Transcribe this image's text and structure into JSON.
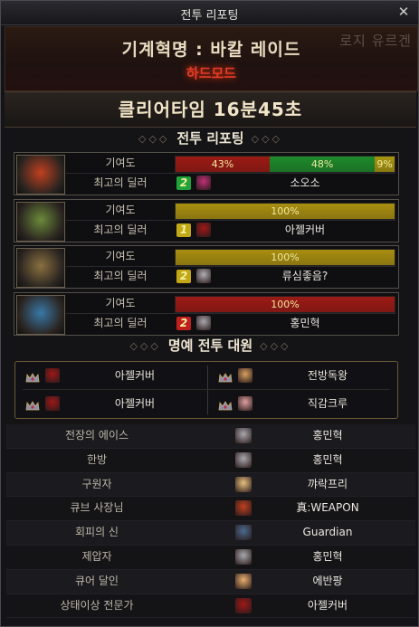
{
  "window": {
    "title": "전투 리포팅",
    "close_label": "✕"
  },
  "header": {
    "raid_name": "기계혁명 : 바칼 레이드",
    "mode": "하드모드",
    "ghost_text": "로지 유르겐"
  },
  "clear_time": "클리어타임 16분45초",
  "sections": {
    "report_title": "전투 리포팅",
    "honor_title": "명예 전투 대원",
    "ornament": "◇◇◇"
  },
  "labels": {
    "contribution": "기여도",
    "best_dealer": "최고의 딜러"
  },
  "parties": [
    {
      "portrait_color": "#c04020",
      "contribution": [
        {
          "pct": 43,
          "label": "43%",
          "color": "#9c1a14"
        },
        {
          "pct": 48,
          "label": "48%",
          "color": "#1e8a2a"
        },
        {
          "pct": 9,
          "label": "9%",
          "color": "#a89510"
        }
      ],
      "dealer_rank": "2",
      "rank_color": "#1fa33a",
      "dealer_face": "#c0307a",
      "dealer_name": "소오소"
    },
    {
      "portrait_color": "#6b8a3a",
      "contribution": [
        {
          "pct": 100,
          "label": "100%",
          "color": "#a98e10"
        }
      ],
      "dealer_rank": "1",
      "rank_color": "#c2a816",
      "dealer_face": "#a01818",
      "dealer_name": "아젤커버"
    },
    {
      "portrait_color": "#8a7040",
      "contribution": [
        {
          "pct": 100,
          "label": "100%",
          "color": "#a98e10"
        }
      ],
      "dealer_rank": "2",
      "rank_color": "#c2a816",
      "dealer_face": "#b0b0b4",
      "dealer_name": "류심좋음?"
    },
    {
      "portrait_color": "#3a78a8",
      "contribution": [
        {
          "pct": 100,
          "label": "100%",
          "color": "#9c1a14"
        }
      ],
      "dealer_rank": "2",
      "rank_color": "#c0201c",
      "dealer_face": "#a8a8ae",
      "dealer_name": "홍민혁"
    }
  ],
  "honor_members": [
    {
      "name": "아젤커버",
      "face": "#a01818"
    },
    {
      "name": "전방독왕",
      "face": "#d8a060"
    },
    {
      "name": "아젤커버",
      "face": "#a01818"
    },
    {
      "name": "직감크루",
      "face": "#e0a0a0"
    }
  ],
  "awards": [
    {
      "title": "전장의 에이스",
      "name": "홍민혁",
      "face": "#a8a8ae"
    },
    {
      "title": "한방",
      "name": "홍민혁",
      "face": "#a8a8ae"
    },
    {
      "title": "구원자",
      "name": "꺄락프리",
      "face": "#e8c080"
    },
    {
      "title": "큐브 사장님",
      "name": "真:WEAPON",
      "face": "#c04020"
    },
    {
      "title": "회피의 신",
      "name": "Guardian",
      "face": "#4a6a90"
    },
    {
      "title": "제압자",
      "name": "홍민혁",
      "face": "#a8a8ae"
    },
    {
      "title": "큐어 달인",
      "name": "에반팡",
      "face": "#e8b070"
    },
    {
      "title": "상태이상 전문가",
      "name": "아젤커버",
      "face": "#a01818"
    }
  ]
}
